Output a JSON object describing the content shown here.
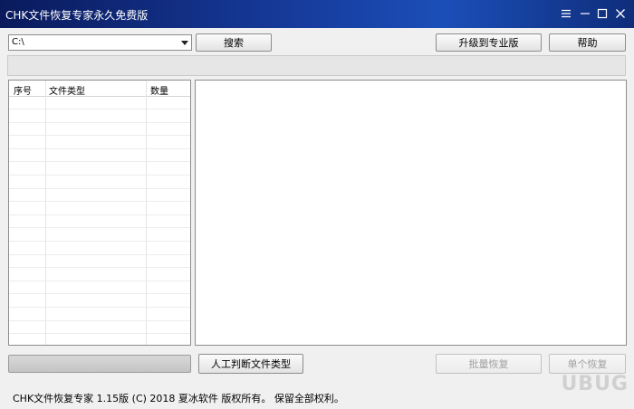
{
  "window": {
    "title": "CHK文件恢复专家永久免费版"
  },
  "toolbar": {
    "drive_value": "C:\\",
    "search_label": "搜索",
    "upgrade_label": "升级到专业版",
    "help_label": "帮助"
  },
  "file_table": {
    "columns": [
      "序号",
      "文件类型",
      "数量"
    ],
    "rows": []
  },
  "actions": {
    "manual_label": "人工判断文件类型",
    "batch_restore_label": "批量恢复",
    "single_restore_label": "单个恢复"
  },
  "status_bar": {
    "text": "CHK文件恢复专家 1.15版 (C) 2018 夏冰软件 版权所有。 保留全部权利。"
  },
  "watermark": {
    "text": "UBUG"
  },
  "icons": {
    "menu": "menu-icon",
    "minimize": "minimize-icon",
    "maximize": "maximize-icon",
    "close": "close-icon",
    "dropdown": "chevron-down-icon"
  },
  "colors": {
    "titlebar_dark": "#0a1a5c",
    "titlebar_light": "#1b4fb8"
  }
}
